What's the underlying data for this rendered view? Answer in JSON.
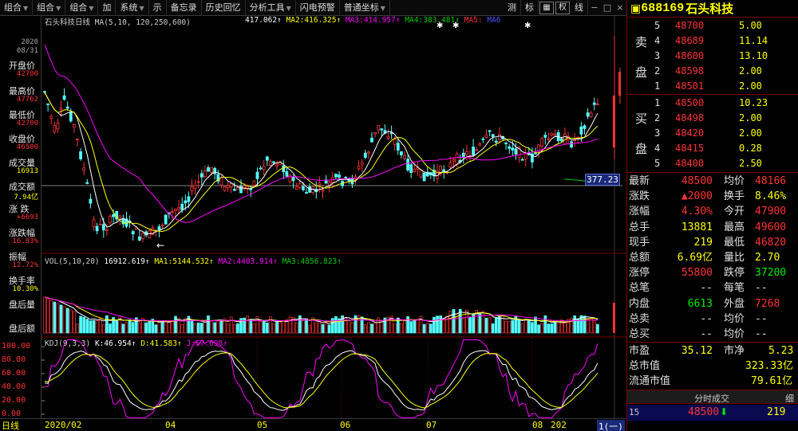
{
  "toolbar": {
    "items": [
      "组合",
      "组合",
      "组合",
      "加",
      "系统",
      "示",
      "备忘录",
      "历史回忆",
      "分析工具",
      "闪电预警",
      "普通坐标"
    ],
    "right_items": [
      "测",
      "标",
      "权",
      "线"
    ],
    "window_controls": [
      "−",
      "□",
      "×"
    ]
  },
  "chart": {
    "stock_title": "石头科技",
    "period_label": "日线",
    "ma_header": {
      "label": "MA(5,10,",
      "params": "120,250,600)",
      "ma1": "417.062",
      "ma2_label": "MA2:",
      "ma2": "416.325",
      "ma3_label": "MA3:",
      "ma3": "414.957",
      "ma4_label": "MA4:",
      "ma4": "383.481",
      "ma5_label": "MA5:",
      "ma6": "MA6"
    },
    "price_marker": "377.23",
    "left_arrow": "←",
    "vol_header": {
      "label": "VOL(5,10,20)",
      "value": "16912.619",
      "ma1_label": "MA1:",
      "ma1": "5144.532",
      "ma2_label": "MA2:",
      "ma2": "4403.914",
      "ma3_label": "MA3:",
      "ma3": "4856.823"
    },
    "kdj_header": {
      "label": "KDJ(9,3,3)",
      "k_label": "K:",
      "k": "46.954",
      "d_label": "D:",
      "d": "41.583",
      "j_label": "J:",
      "j": "57.698"
    },
    "kdj_axis": [
      "100.00",
      "80.00",
      "60.00",
      "40.00",
      "20.00",
      "0.00"
    ],
    "x_axis": [
      "2020/02",
      "04",
      "05",
      "06",
      "07",
      "08",
      "202",
      "1(一)"
    ],
    "colors": {
      "up": "#ff3232",
      "down": "#54ffff",
      "ma_white": "#ffffff",
      "ma_yellow": "#ffff00",
      "ma_magenta": "#ff00ff",
      "ma_green": "#00cc00"
    }
  },
  "left_panel": {
    "date_year": "2020",
    "date_day": "08/31",
    "fields": [
      {
        "label": "开盘价",
        "value": "42700"
      },
      {
        "label": "最高价",
        "value": "47762"
      },
      {
        "label": "最低价",
        "value": "42700"
      },
      {
        "label": "收盘价",
        "value": "46500"
      },
      {
        "label": "成交量",
        "value": "16913"
      },
      {
        "label": "成交额",
        "value": "7.94亿"
      },
      {
        "label": "涨 跌",
        "value": "+6693"
      },
      {
        "label": "涨跌幅",
        "value": "16.83%"
      },
      {
        "label": "振幅",
        "value": "12.72%"
      },
      {
        "label": "换手率",
        "value": "10.30%"
      },
      {
        "label": "盘后量",
        "value": ""
      },
      {
        "label": "盘后额",
        "value": ""
      }
    ]
  },
  "right_panel": {
    "code": "688169",
    "name": "石头科技",
    "sell_label_1": "卖",
    "sell_label_2": "盘",
    "buy_label_1": "买",
    "buy_label_2": "盘",
    "sell": [
      {
        "level": "5",
        "price": "48700",
        "vol": "5.00"
      },
      {
        "level": "4",
        "price": "48689",
        "vol": "11.14"
      },
      {
        "level": "3",
        "price": "48600",
        "vol": "13.10"
      },
      {
        "level": "2",
        "price": "48598",
        "vol": "2.00"
      },
      {
        "level": "1",
        "price": "48501",
        "vol": "2.00"
      }
    ],
    "buy": [
      {
        "level": "1",
        "price": "48500",
        "vol": "10.23"
      },
      {
        "level": "2",
        "price": "48498",
        "vol": "2.00"
      },
      {
        "level": "3",
        "price": "48420",
        "vol": "2.00"
      },
      {
        "level": "4",
        "price": "48415",
        "vol": "0.28"
      },
      {
        "level": "5",
        "price": "48400",
        "vol": "2.50"
      }
    ],
    "quote": [
      {
        "l": "最新",
        "lv": "48500",
        "lc": "#ff3333",
        "r": "均价",
        "rv": "48166",
        "rc": "#ff3333"
      },
      {
        "l": "涨跌",
        "lv": "▲2000",
        "lc": "#ff3333",
        "r": "换手",
        "rv": "8.46%",
        "rc": "#ffff00"
      },
      {
        "l": "涨幅",
        "lv": "4.30%",
        "lc": "#ff3333",
        "r": "今开",
        "rv": "47900",
        "rc": "#ff3333"
      },
      {
        "l": "总手",
        "lv": "13881",
        "lc": "#ffff00",
        "r": "最高",
        "rv": "49600",
        "rc": "#ff3333"
      },
      {
        "l": "现手",
        "lv": "219",
        "lc": "#ffff00",
        "r": "最低",
        "rv": "46820",
        "rc": "#ff3333"
      },
      {
        "l": "总额",
        "lv": "6.69亿",
        "lc": "#ffff00",
        "r": "量比",
        "rv": "2.70",
        "rc": "#ffff00"
      },
      {
        "l": "涨停",
        "lv": "55800",
        "lc": "#ff3333",
        "r": "跌停",
        "rv": "37200",
        "rc": "#00ee00"
      },
      {
        "l": "总笔",
        "lv": "--",
        "lc": "#e0e0e0",
        "r": "每笔",
        "rv": "--",
        "rc": "#e0e0e0"
      },
      {
        "l": "内盘",
        "lv": "6613",
        "lc": "#00ee00",
        "r": "外盘",
        "rv": "7268",
        "rc": "#ff3333"
      },
      {
        "l": "总卖",
        "lv": "--",
        "lc": "#e0e0e0",
        "r": "均价",
        "rv": "--",
        "rc": "#e0e0e0"
      },
      {
        "l": "总买",
        "lv": "--",
        "lc": "#e0e0e0",
        "r": "均价",
        "rv": "--",
        "rc": "#e0e0e0"
      }
    ],
    "valuation": [
      {
        "l": "市盈",
        "lv": "35.12",
        "r": "市净",
        "rv": "5.23"
      }
    ],
    "market_cap_label": "总市值",
    "market_cap": "323.33亿",
    "float_cap_label": "流通市值",
    "float_cap": "79.61亿",
    "ticks_title": "分时成交",
    "ticks_title_right": "细",
    "tick": {
      "time": "15",
      "price": "48500",
      "arrow": "⬇",
      "vol": "219"
    }
  }
}
